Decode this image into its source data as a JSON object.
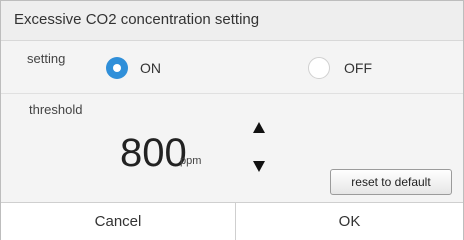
{
  "dialog": {
    "title": "Excessive CO2 concentration setting"
  },
  "setting": {
    "label": "setting",
    "options": [
      {
        "label": "ON",
        "selected": true
      },
      {
        "label": "OFF",
        "selected": false
      }
    ]
  },
  "threshold": {
    "label": "threshold",
    "value": "800",
    "unit": "ppm",
    "reset_label": "reset to default"
  },
  "footer": {
    "cancel_label": "Cancel",
    "ok_label": "OK"
  },
  "colors": {
    "accent": "#2f8fd9",
    "header_bg": "#eeeeee",
    "panel_bg": "#f4f4f4"
  },
  "icons": [
    "radio-selected-icon",
    "radio-unselected-icon",
    "arrow-up-icon",
    "arrow-down-icon"
  ]
}
